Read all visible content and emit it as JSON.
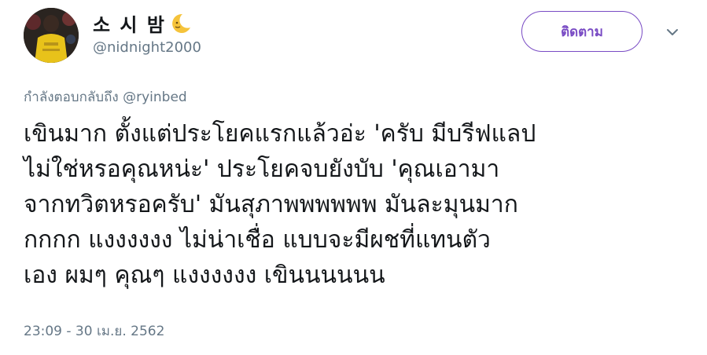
{
  "author": {
    "display_name": "소 시 밤",
    "display_name_emoji": "crescent-moon-face-icon",
    "handle": "@nidnight2000"
  },
  "follow_button": {
    "label": "ติดตาม"
  },
  "menu": {
    "icon": "chevron-down-icon"
  },
  "reply_context": {
    "prefix": "กำลังตอบกลับถึง ",
    "mention": "@ryinbed"
  },
  "tweet": {
    "text": "เขินมาก ตั้งแต่ประโยคแรกแล้วอ่ะ 'ครับ มีบรีฟแลป\nไม่ใช่หรอคุณหน่ะ' ประโยคจบยังบับ 'คุณเอามา\nจากทวิตหรอครับ'  มันสุภาพพพพพพ มันละมุนมาก\nกกกก  แงงงงงง ไม่น่าเชื่อ แบบจะมีผชที่แทนตัว\nเอง ผมๆ คุณๆ แงงงงงง เขินนนนนน",
    "timestamp": "23:09 - 30 เม.ย. 2562"
  },
  "colors": {
    "accent": "#794bc4",
    "secondary_text": "#657786",
    "primary_text": "#14171a"
  }
}
